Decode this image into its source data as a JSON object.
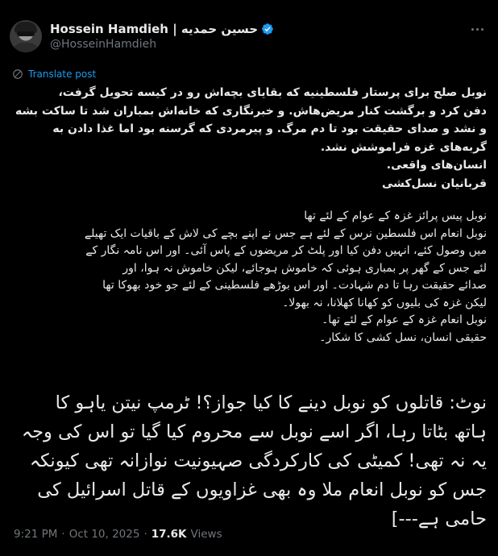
{
  "author": {
    "display_name": "Hossein Hamdieh | حسین حمدیه",
    "handle": "@HosseinHamdieh",
    "verified_icon": "verified-badge-icon",
    "verified_color": "#1d9bf0"
  },
  "translate_label": "Translate post",
  "persian_lines": [
    "نوبل صلح برای پرستار فلسطینیه که بقایای بچه‌اش رو در کیسه تحویل گرفت،",
    "دفن کرد و برگشت کنار مریض‌هاش. و خبرنگاری که خانه‌اش بمباران شد تا ساکت بشه",
    "و نشد و صدای حقیقت بود تا دم مرگ. و پیرمردی که گرسنه بود اما غذا دادن به",
    "گربه‌های غزه فراموشش نشد.",
    "انسان‌های واقعی.",
    "قربانیان نسل‌کشی"
  ],
  "urdu_lines": [
    "نوبل پیس پرائز غزہ کے عوام کے لئے تھا",
    "نوبل انعام اس فلسطین نرس کے لئے ہے جس نے اپنے بچے کی لاش کے باقیات ایک تھیلے",
    "میں وصول کئے، انہیں دفن کیا اور پلٹ کر مریضوں کے پاس آئی۔ اور اس نامہ نگار کے",
    "لئے جس کے گھر پر بمباری ہوئی کہ خاموش ہوجائے، لیکن خاموش نہ ہوا، اور",
    "صدائے حقیقت رہا تا دم شہادت۔ اور اس بوڑھے فلسطینی کے لئے جو خود بھوکا تھا",
    "لیکن غزہ کی بلیوں کو کھانا کھلانا، نہ بھولا۔",
    "نوبل انعام غزہ کے عوام کے لئے تھا۔",
    "حقیقی انسان، نسل کشی کا شکار۔"
  ],
  "note_lines": [
    "نوٹ: قاتلوں کو نوبل دینے کا کیا جواز؟! ٹرمپ نیتن یاہو کا",
    "ہاتھ بٹاتا رہا، اگر اسے نوبل سے محروم کیا گیا تو اس کی وجہ",
    "یہ نہ تھی! کمیٹی کی کارکردگی صہیونیت نوازانہ تھی کیونکہ",
    "جس کو نوبل انعام ملا وہ بھی غزاویوں کے قاتل اسرائیل کی",
    "حامی ہے---]"
  ],
  "meta": {
    "time": "9:21 PM",
    "separator": "·",
    "date": "Oct 10, 2025",
    "views_count": "17.6K",
    "views_label": "Views"
  }
}
